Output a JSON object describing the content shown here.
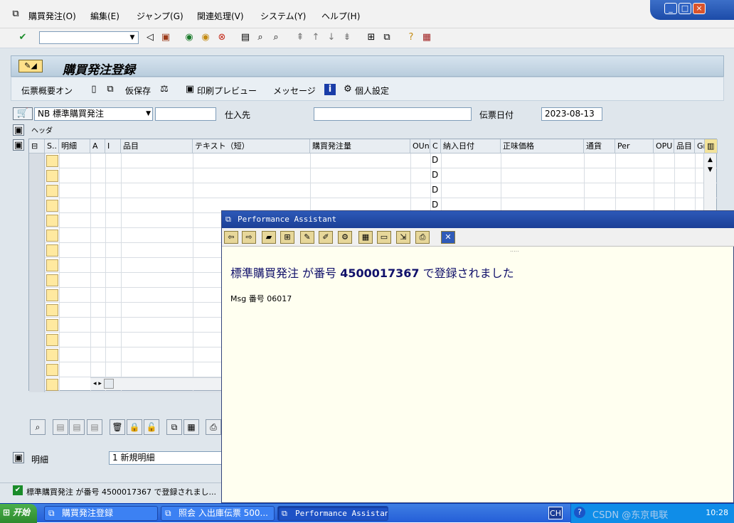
{
  "menubar": {
    "items": [
      "購買発注(O)",
      "編集(E)",
      "ジャンプ(G)",
      "関連処理(V)",
      "システム(Y)",
      "ヘルプ(H)"
    ]
  },
  "window_controls": {
    "minimize": "_",
    "restore": "□",
    "close": "×"
  },
  "toolbar": {
    "command_field": ""
  },
  "screen": {
    "title": "購買発注登録"
  },
  "appbar": {
    "doc_overview": "伝票概要オン",
    "hold": "仮保存",
    "print_preview": "印刷プレビュー",
    "messages": "メッセージ",
    "personal_settings": "個人設定"
  },
  "header": {
    "doc_type": "NB 標準購買発注",
    "doc_number": "",
    "vendor_label": "仕入先",
    "vendor_value": "",
    "doc_date_label": "伝票日付",
    "doc_date": "2023-08-13",
    "header_label": "ヘッダ"
  },
  "grid": {
    "columns": [
      "S..",
      "明細",
      "A",
      "I",
      "品目",
      "テキスト（短）",
      "購買発注量",
      "OUn",
      "C",
      "納入日付",
      "正味価格",
      "通貨",
      "Per",
      "OPU",
      "品目",
      "Gr"
    ],
    "c_values": [
      "D",
      "D",
      "D",
      "D"
    ]
  },
  "item_detail": {
    "label": "明細",
    "selector": "1 新規明細"
  },
  "status": {
    "message": "標準購買発注 が番号 4500017367 で登録されまし..."
  },
  "assistant": {
    "title": "Performance Assistant",
    "headline_prefix": "標準購買発注 が番号 ",
    "doc_no": "4500017367",
    "headline_suffix": " で登録されました",
    "msg_no": "Msg 番号 06017"
  },
  "taskbar": {
    "start": "开始",
    "tasks": [
      "購買発注登録",
      "照会 入出庫伝票 500...",
      "Performance Assistant"
    ],
    "lang": "CH",
    "watermark": "CSDN @东京电联",
    "time": "10:28"
  }
}
